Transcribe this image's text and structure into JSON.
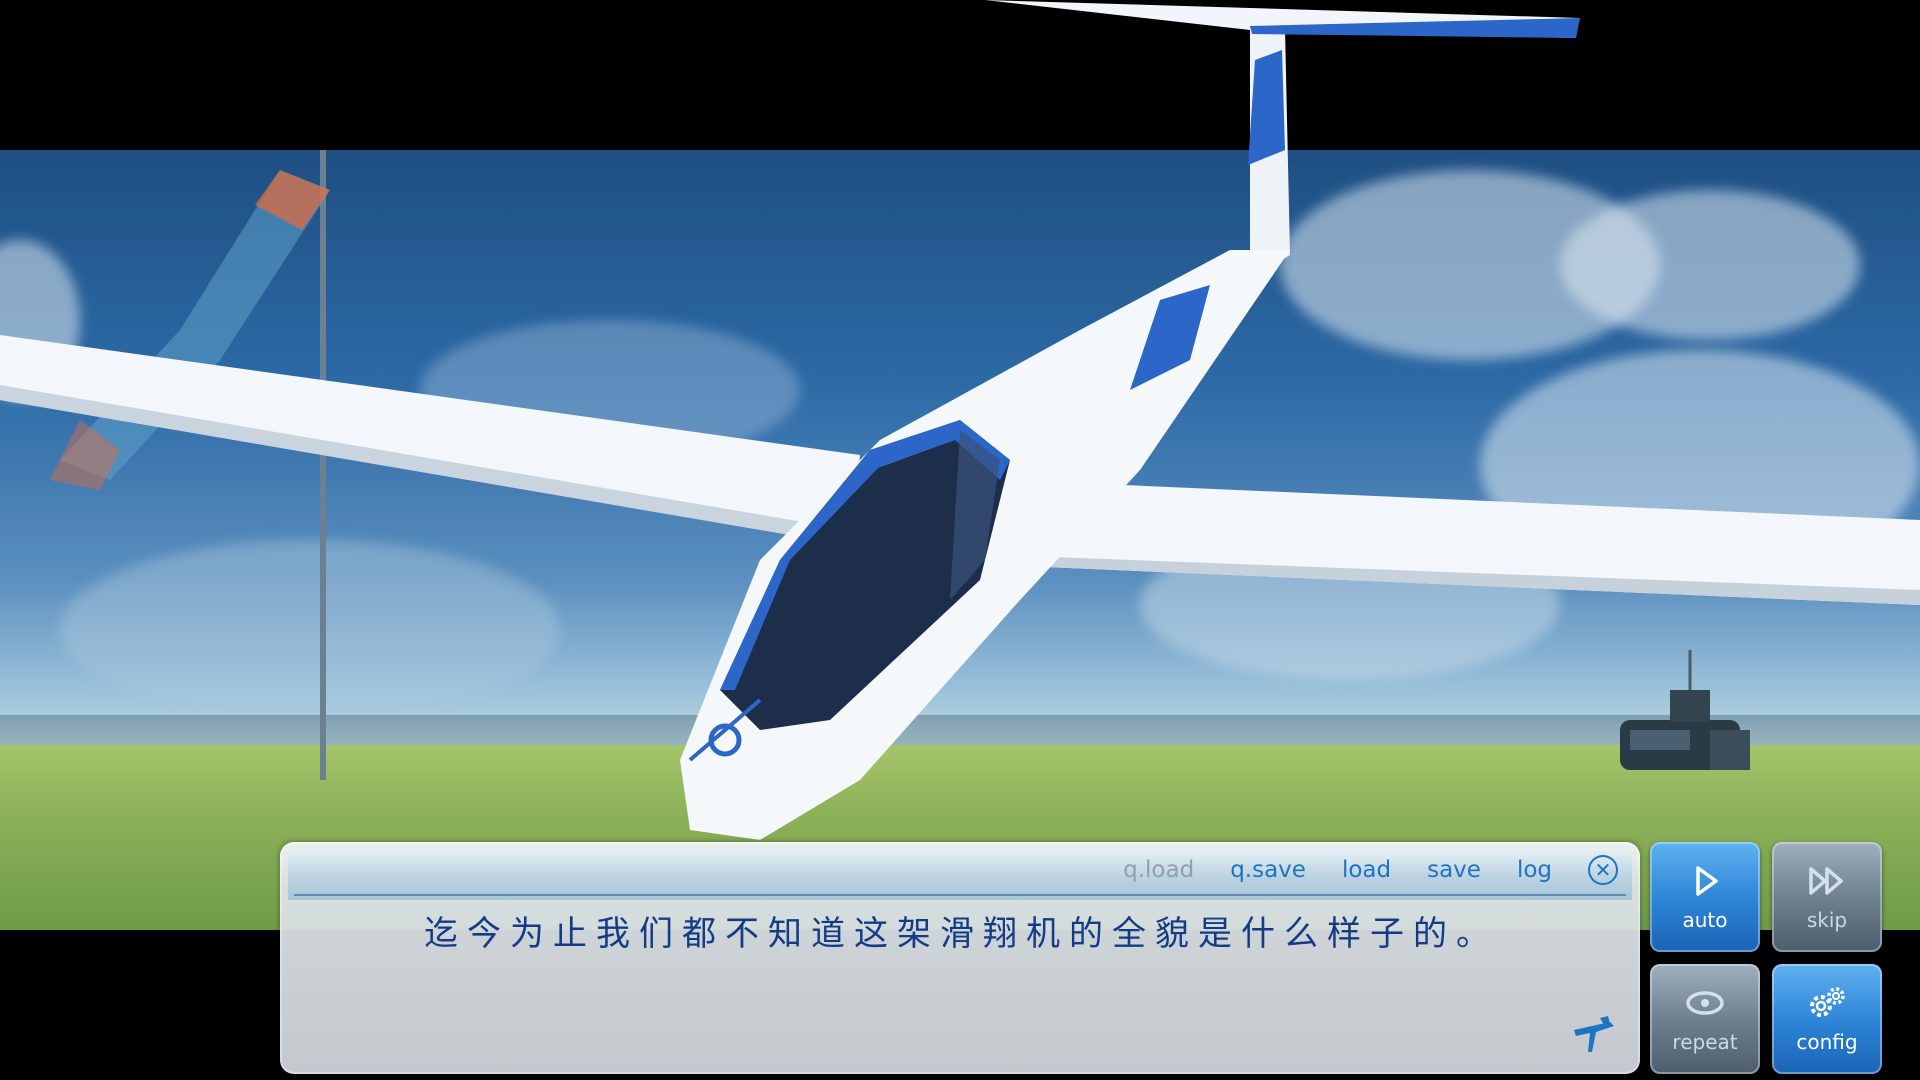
{
  "dialog": {
    "text": "迄今为止我们都不知道这架滑翔机的全貌是什么样子的。",
    "menu": [
      "q.load",
      "q.save",
      "load",
      "save",
      "log"
    ],
    "close_label": "✕"
  },
  "buttons": {
    "auto": "auto",
    "skip": "skip",
    "repeat": "repeat",
    "config": "config"
  },
  "colors": {
    "accent": "#1e74c4",
    "dialog_text": "#143c86",
    "button_blue": "#2f86d8",
    "button_grey": "#6e8191"
  },
  "icons": [
    "play-icon",
    "fast-forward-icon",
    "repeat-icon",
    "gear-icon",
    "close-icon",
    "glider-icon"
  ]
}
